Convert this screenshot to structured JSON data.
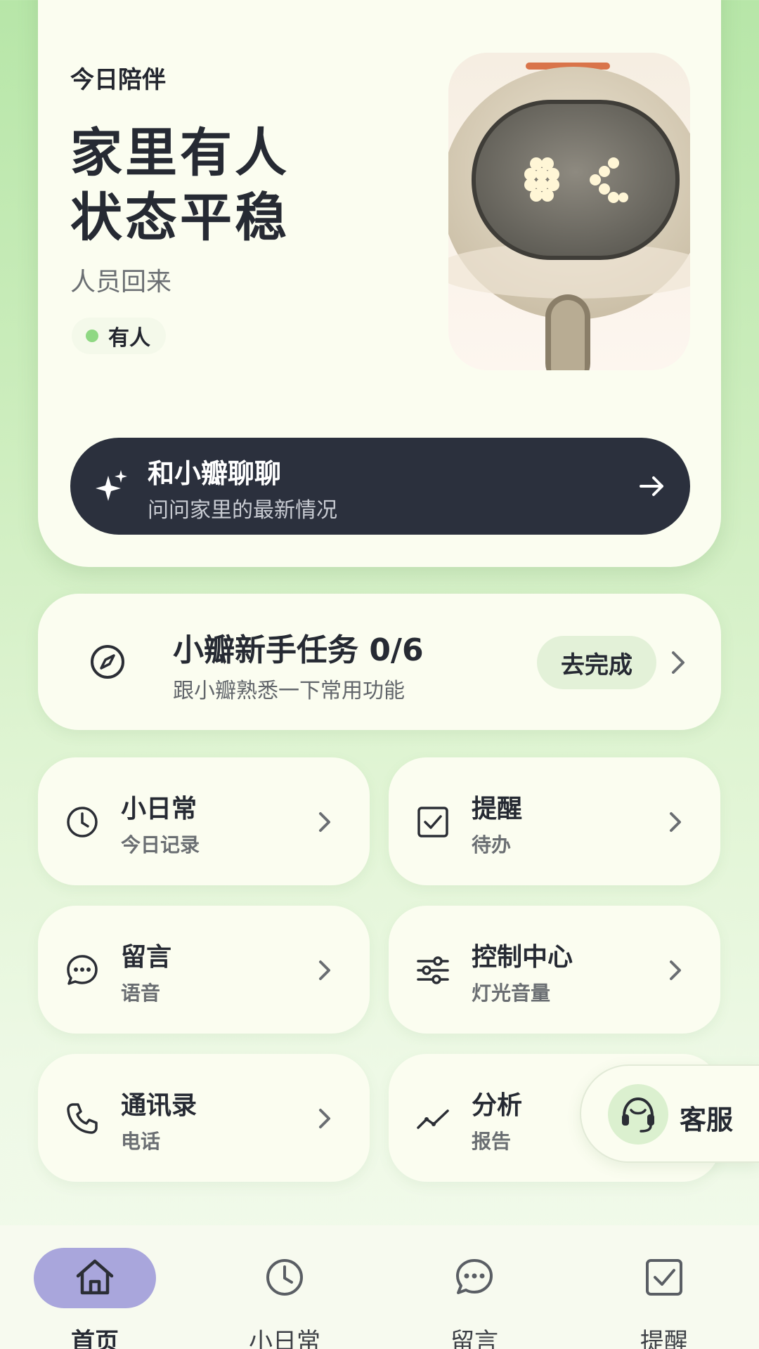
{
  "hero": {
    "kicker": "今日陪伴",
    "title_line1": "家里有人",
    "title_line2": "状态平稳",
    "subtitle": "人员回来",
    "status_label": "有人",
    "status_color": "#8fd883"
  },
  "chat": {
    "title": "和小瓣聊聊",
    "subtitle": "问问家里的最新情况",
    "icon": "sparkles-icon",
    "arrow_icon": "arrow-right-icon"
  },
  "task": {
    "title": "小瓣新手任务 0/6",
    "subtitle": "跟小瓣熟悉一下常用功能",
    "button": "去完成",
    "icon": "compass-icon"
  },
  "tiles": [
    {
      "title": "小日常",
      "subtitle": "今日记录",
      "icon": "clock-icon"
    },
    {
      "title": "提醒",
      "subtitle": "待办",
      "icon": "checkbox-icon"
    },
    {
      "title": "留言",
      "subtitle": "语音",
      "icon": "chat-bubble-icon"
    },
    {
      "title": "控制中心",
      "subtitle": "灯光音量",
      "icon": "sliders-icon"
    },
    {
      "title": "通讯录",
      "subtitle": "电话",
      "icon": "phone-icon"
    },
    {
      "title": "分析",
      "subtitle": "报告",
      "icon": "trend-line-icon"
    }
  ],
  "customer_service": {
    "label": "客服",
    "icon": "headset-icon"
  },
  "nav": [
    {
      "label": "首页",
      "icon": "home-icon",
      "active": true
    },
    {
      "label": "小日常",
      "icon": "clock-icon",
      "active": false
    },
    {
      "label": "留言",
      "icon": "chat-bubble-icon",
      "active": false
    },
    {
      "label": "提醒",
      "icon": "checkbox-icon",
      "active": false
    }
  ],
  "colors": {
    "accent_dark": "#2b303d",
    "nav_active": "#a9a6dc",
    "pill_green": "#e3f1d8"
  }
}
